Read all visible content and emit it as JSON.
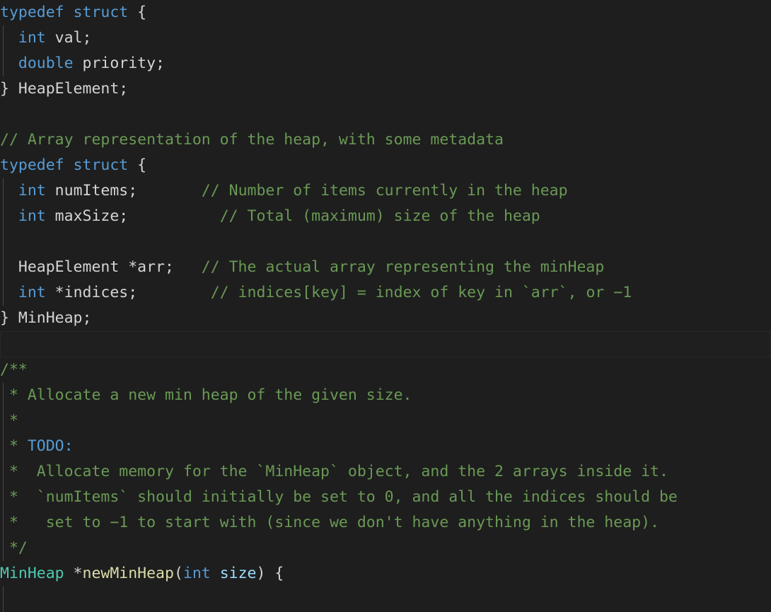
{
  "editor": {
    "language": "c",
    "theme": "Dark+ (default dark)",
    "background_color": "#1e1e1e",
    "colors": {
      "foreground": "#d4d4d4",
      "keyword": "#569cd6",
      "comment": "#6a9955",
      "type": "#4ec9b0",
      "function": "#dcdcaa",
      "parameter": "#9cdcfe",
      "indent_guide": "#484848",
      "current_line_border": "#282828"
    },
    "lines": [
      {
        "id": "l1",
        "guide": false,
        "current": false,
        "tokens": [
          {
            "t": "typedef",
            "c": "key"
          },
          {
            "t": " ",
            "c": "plain"
          },
          {
            "t": "struct",
            "c": "key"
          },
          {
            "t": " {",
            "c": "plain"
          }
        ]
      },
      {
        "id": "l2",
        "guide": true,
        "current": false,
        "tokens": [
          {
            "t": "  ",
            "c": "plain"
          },
          {
            "t": "int",
            "c": "key"
          },
          {
            "t": " val;",
            "c": "plain"
          }
        ]
      },
      {
        "id": "l3",
        "guide": true,
        "current": false,
        "tokens": [
          {
            "t": "  ",
            "c": "plain"
          },
          {
            "t": "double",
            "c": "key"
          },
          {
            "t": " priority;",
            "c": "plain"
          }
        ]
      },
      {
        "id": "l4",
        "guide": false,
        "current": false,
        "tokens": [
          {
            "t": "} HeapElement;",
            "c": "plain"
          }
        ]
      },
      {
        "id": "l5",
        "guide": false,
        "current": false,
        "tokens": []
      },
      {
        "id": "l6",
        "guide": false,
        "current": false,
        "tokens": [
          {
            "t": "// Array representation of the heap, with some metadata",
            "c": "comment"
          }
        ]
      },
      {
        "id": "l7",
        "guide": false,
        "current": false,
        "tokens": [
          {
            "t": "typedef",
            "c": "key"
          },
          {
            "t": " ",
            "c": "plain"
          },
          {
            "t": "struct",
            "c": "key"
          },
          {
            "t": " {",
            "c": "plain"
          }
        ]
      },
      {
        "id": "l8",
        "guide": true,
        "current": false,
        "tokens": [
          {
            "t": "  ",
            "c": "plain"
          },
          {
            "t": "int",
            "c": "key"
          },
          {
            "t": " numItems;       ",
            "c": "plain"
          },
          {
            "t": "// Number of items currently in the heap",
            "c": "comment"
          }
        ]
      },
      {
        "id": "l9",
        "guide": true,
        "current": false,
        "tokens": [
          {
            "t": "  ",
            "c": "plain"
          },
          {
            "t": "int",
            "c": "key"
          },
          {
            "t": " maxSize;          ",
            "c": "plain"
          },
          {
            "t": "// Total (maximum) size of the heap",
            "c": "comment"
          }
        ]
      },
      {
        "id": "l10",
        "guide": true,
        "current": false,
        "tokens": []
      },
      {
        "id": "l11",
        "guide": true,
        "current": false,
        "tokens": [
          {
            "t": "  HeapElement *arr;   ",
            "c": "plain"
          },
          {
            "t": "// The actual array representing the minHeap",
            "c": "comment"
          }
        ]
      },
      {
        "id": "l12",
        "guide": true,
        "current": false,
        "tokens": [
          {
            "t": "  ",
            "c": "plain"
          },
          {
            "t": "int",
            "c": "key"
          },
          {
            "t": " *indices;        ",
            "c": "plain"
          },
          {
            "t": "// indices[key] = index of key in `arr`, or −1",
            "c": "comment"
          }
        ]
      },
      {
        "id": "l13",
        "guide": false,
        "current": false,
        "tokens": [
          {
            "t": "} MinHeap;",
            "c": "plain"
          }
        ]
      },
      {
        "id": "l14",
        "guide": false,
        "current": true,
        "tokens": []
      },
      {
        "id": "l15",
        "guide": false,
        "current": false,
        "tokens": [
          {
            "t": "/**",
            "c": "comment"
          }
        ]
      },
      {
        "id": "l16",
        "guide": true,
        "current": false,
        "tokens": [
          {
            "t": " * Allocate a new min heap of the given size.",
            "c": "comment"
          }
        ]
      },
      {
        "id": "l17",
        "guide": true,
        "current": false,
        "tokens": [
          {
            "t": " *",
            "c": "comment"
          }
        ]
      },
      {
        "id": "l18",
        "guide": true,
        "current": false,
        "tokens": [
          {
            "t": " * ",
            "c": "comment"
          },
          {
            "t": "TODO:",
            "c": "todo"
          }
        ]
      },
      {
        "id": "l19",
        "guide": true,
        "current": false,
        "tokens": [
          {
            "t": " *  Allocate memory for the `MinHeap` object, and the 2 arrays inside it.",
            "c": "comment"
          }
        ]
      },
      {
        "id": "l20",
        "guide": true,
        "current": false,
        "tokens": [
          {
            "t": " *  `numItems` should initially be set to 0, and all the indices should be",
            "c": "comment"
          }
        ]
      },
      {
        "id": "l21",
        "guide": true,
        "current": false,
        "tokens": [
          {
            "t": " *   set to −1 to start with (since we don't have anything in the heap).",
            "c": "comment"
          }
        ]
      },
      {
        "id": "l22",
        "guide": true,
        "current": false,
        "tokens": [
          {
            "t": " */",
            "c": "comment"
          }
        ]
      },
      {
        "id": "l23",
        "guide": false,
        "current": false,
        "tokens": [
          {
            "t": "MinHeap",
            "c": "type"
          },
          {
            "t": " *",
            "c": "plain"
          },
          {
            "t": "newMinHeap",
            "c": "func"
          },
          {
            "t": "(",
            "c": "plain"
          },
          {
            "t": "int",
            "c": "key"
          },
          {
            "t": " ",
            "c": "plain"
          },
          {
            "t": "size",
            "c": "param"
          },
          {
            "t": ") {",
            "c": "plain"
          }
        ]
      },
      {
        "id": "l24",
        "guide": true,
        "current": false,
        "tokens": []
      }
    ]
  }
}
